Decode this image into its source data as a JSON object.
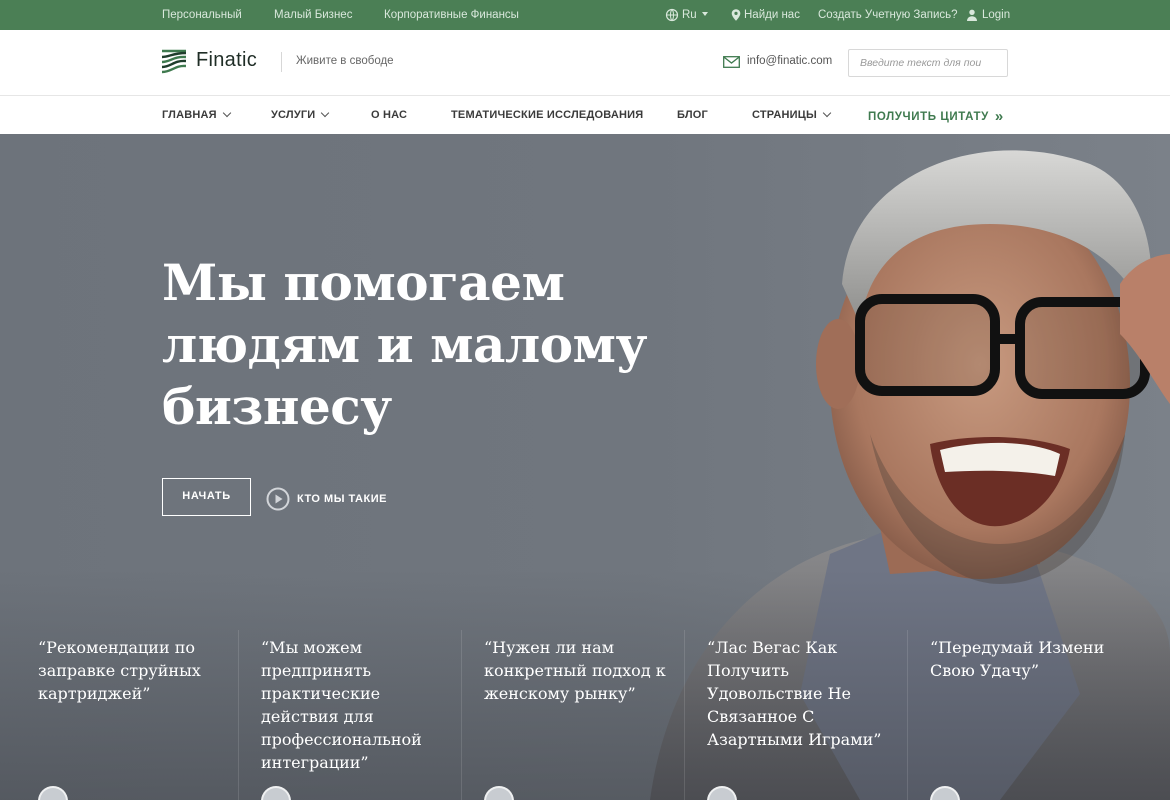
{
  "topbar": {
    "links": [
      "Персональный",
      "Малый Бизнес",
      "Корпоративные Финансы"
    ],
    "language": "Ru",
    "find_us": "Найди нас",
    "create_account": "Создать Учетную Запись?",
    "login": "Login"
  },
  "header": {
    "logo": "Finatic",
    "tagline": "Живите в свободе",
    "email": "info@finatic.com",
    "search_placeholder": "Введите текст для пои"
  },
  "nav": {
    "items": [
      "ГЛАВНАЯ",
      "УСЛУГИ",
      "О НАС",
      "ТЕМАТИЧЕСКИЕ ИССЛЕДОВАНИЯ",
      "БЛОГ",
      "СТРАНИЦЫ"
    ],
    "cta": "ПОЛУЧИТЬ ЦИТАТУ"
  },
  "hero": {
    "title_lines": [
      "Мы помогаем",
      "людям и малому",
      "бизнесу"
    ],
    "start_button": "НАЧАТЬ",
    "who_we_are": "КТО МЫ ТАКИЕ"
  },
  "testimonials": [
    {
      "lines": [
        "“Рекомендации по",
        "заправке струйных",
        "картриджей”"
      ]
    },
    {
      "lines": [
        "“Мы можем",
        "предпринять",
        "практические",
        "действия для",
        "профессиональной",
        "интеграции”"
      ]
    },
    {
      "lines": [
        "“Нужен ли нам",
        "конкретный подход к",
        "женскому рынку”"
      ]
    },
    {
      "lines": [
        "“Лас Вегас Как",
        "Получить",
        "Удовольствие Не",
        "Связанное С",
        "Азартными Играми”"
      ]
    },
    {
      "lines": [
        "“Передумай Измени",
        "Свою Удачу”"
      ]
    }
  ],
  "colors": {
    "topbar": "#4b7f55",
    "accent": "#3f7a4f",
    "hero_bg": "#70767e"
  }
}
